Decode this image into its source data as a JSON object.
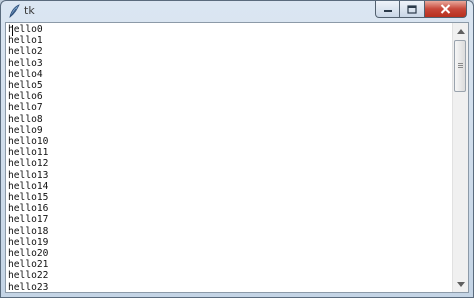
{
  "window": {
    "title": "tk",
    "icon": "feather-icon",
    "controls": [
      "minimize-icon",
      "maximize-icon",
      "close-icon"
    ]
  },
  "text_widget": {
    "lines": [
      "hello0",
      "hello1",
      "hello2",
      "hello3",
      "hello4",
      "hello5",
      "hello6",
      "hello7",
      "hello8",
      "hello9",
      "hello10",
      "hello11",
      "hello12",
      "hello13",
      "hello14",
      "hello15",
      "hello16",
      "hello17",
      "hello18",
      "hello19",
      "hello20",
      "hello21",
      "hello22",
      "hello23"
    ]
  },
  "scrollbar": {
    "orientation": "vertical",
    "position": 0.0,
    "visible_fraction": 0.24
  },
  "colors": {
    "title_bar": "#c4d4e5",
    "close_button": "#c7473a",
    "text_background": "#ffffff"
  }
}
